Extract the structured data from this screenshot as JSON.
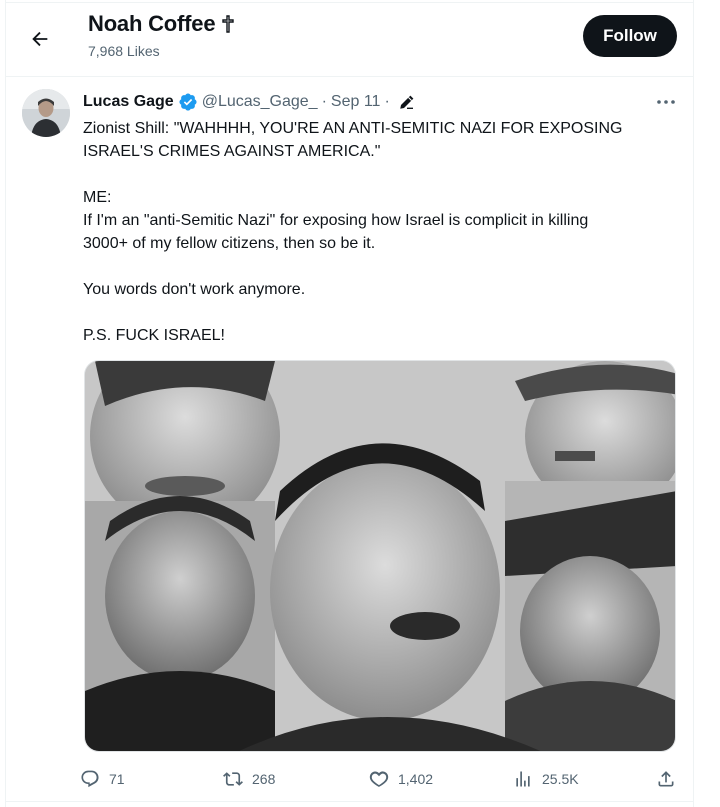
{
  "header": {
    "profile_name": "Noah Coffee",
    "name_suffix_icon": "cross-emoji",
    "likes_label": "7,968 Likes",
    "follow_label": "Follow"
  },
  "tweet": {
    "author_name": "Lucas Gage",
    "verified": true,
    "handle": "@Lucas_Gage_",
    "separator": "·",
    "date": "Sep 11",
    "edited": true,
    "text_lines": [
      "Zionist Shill: \"WAHHHH, YOU'RE AN ANTI-SEMITIC NAZI FOR EXPOSING",
      "ISRAEL'S CRIMES AGAINST AMERICA.\"",
      "",
      "ME:",
      "If I'm an \"anti-Semitic Nazi\" for exposing how Israel is complicit in killing",
      "3000+ of my fellow citizens, then so be it.",
      "",
      "You words don't work anymore.",
      "",
      "P.S. FUCK ISRAEL!"
    ],
    "media_description": "collage of five black-and-white photos of a laughing man",
    "stats": {
      "replies": "71",
      "retweets": "268",
      "likes": "1,402",
      "views": "25.5K"
    }
  },
  "colors": {
    "text_primary": "#0f1419",
    "text_secondary": "#536471",
    "verified_blue": "#1d9bf0",
    "follow_bg": "#0f1419",
    "divider": "#eff3f4"
  }
}
